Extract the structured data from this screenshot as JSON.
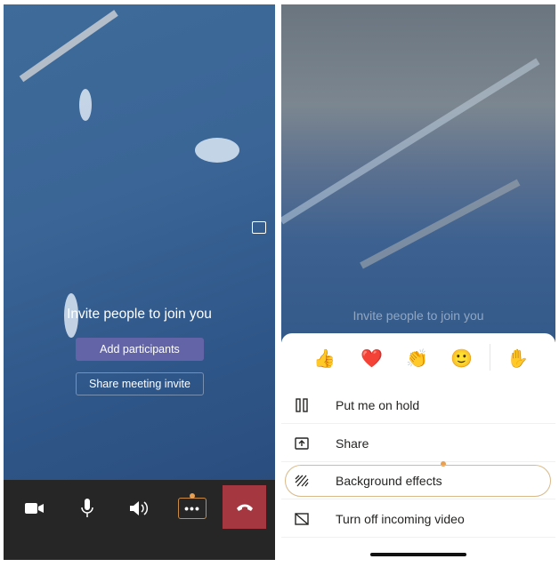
{
  "left_screen": {
    "invite_text": "Invite people to join you",
    "add_participants_label": "Add participants",
    "share_invite_label": "Share meeting invite",
    "toolbar": {
      "icons": [
        "video-camera-icon",
        "microphone-icon",
        "speaker-icon",
        "more-icon",
        "hang-up-icon"
      ],
      "hangup_color": "#a4373f",
      "more_accent": "#c98a43"
    }
  },
  "right_screen": {
    "background_text": "Invite people to join you",
    "reactions": [
      "👍",
      "❤️",
      "👏",
      "🙂",
      "✋"
    ],
    "menu": [
      {
        "label": "Put me on hold",
        "icon": "pause-icon"
      },
      {
        "label": "Share",
        "icon": "share-screen-icon"
      },
      {
        "label": "Background effects",
        "icon": "background-effects-icon",
        "highlighted": true
      },
      {
        "label": "Turn off incoming video",
        "icon": "video-off-icon"
      }
    ]
  }
}
